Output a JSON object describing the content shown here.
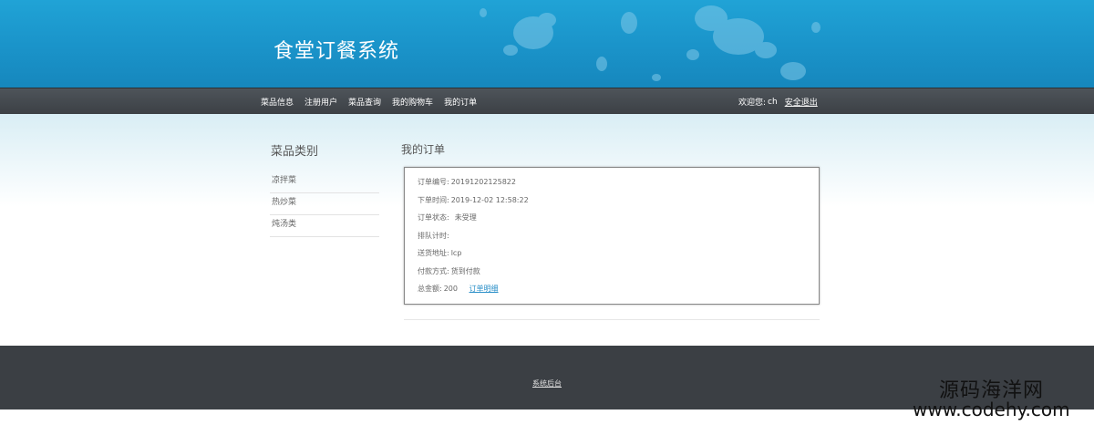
{
  "header": {
    "site_title": "食堂订餐系统"
  },
  "nav": {
    "items": [
      {
        "label": "菜品信息"
      },
      {
        "label": "注册用户"
      },
      {
        "label": "菜品查询"
      },
      {
        "label": "我的购物车"
      },
      {
        "label": "我的订单"
      }
    ],
    "welcome_label": "欢迎您:",
    "username": "ch",
    "logout_label": "安全退出"
  },
  "sidebar": {
    "title": "菜品类别",
    "categories": [
      {
        "label": "凉拌菜"
      },
      {
        "label": "热炒菜"
      },
      {
        "label": "炖汤类"
      }
    ]
  },
  "orders": {
    "title": "我的订单",
    "order": {
      "order_no_label": "订单编号:",
      "order_no": "20191202125822",
      "order_time_label": "下单时间:",
      "order_time": "2019-12-02 12:58:22",
      "status_label": "订单状态:",
      "status": "未受理",
      "queue_label": "排队计时:",
      "queue": "",
      "address_label": "送货地址:",
      "address": "lcp",
      "payment_label": "付款方式:",
      "payment": "货到付款",
      "total_label": "总金额:",
      "total": "200",
      "detail_link": "订单明细"
    }
  },
  "footer": {
    "admin_link": "系统后台"
  },
  "watermark": {
    "text": "源码海洋网",
    "url": "www.codehy.com"
  },
  "colors": {
    "banner": "#1a93c9",
    "navbar": "#44494e",
    "footer": "#3b3f44",
    "link": "#2a8fc8"
  }
}
